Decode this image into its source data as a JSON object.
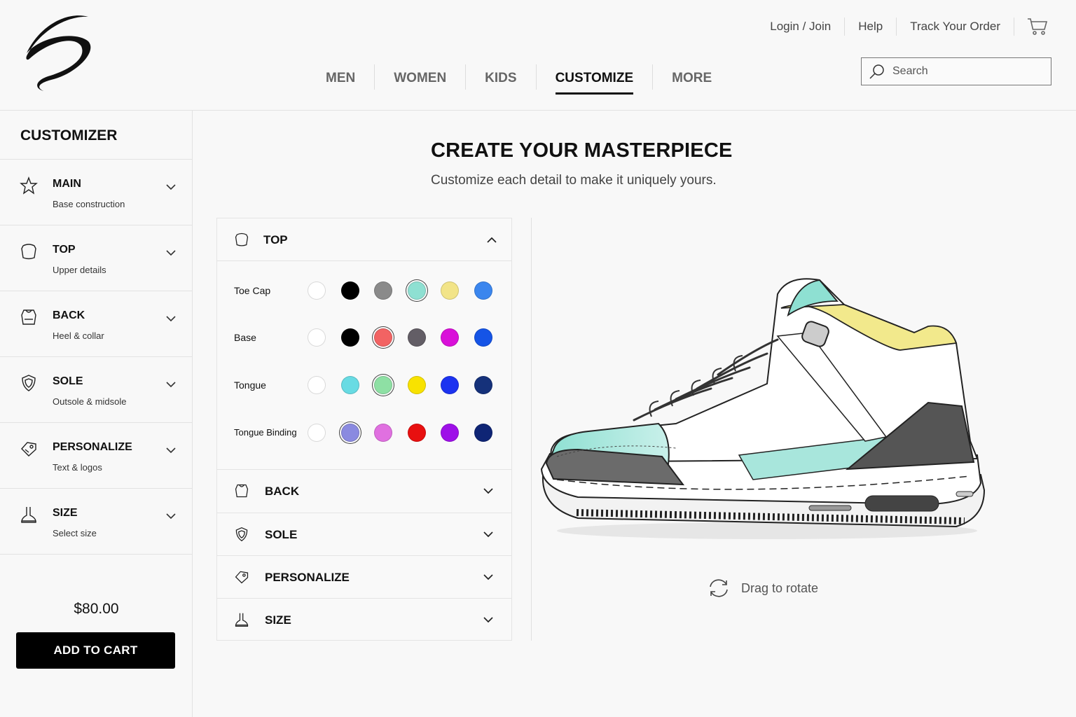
{
  "header": {
    "util_links": [
      "Login / Join",
      "Help",
      "Track Your Order"
    ],
    "nav": [
      "MEN",
      "WOMEN",
      "KIDS",
      "CUSTOMIZE",
      "MORE"
    ],
    "active_nav": "CUSTOMIZE",
    "search_placeholder": "Search"
  },
  "sidebar": {
    "title": "CUSTOMIZER",
    "items": [
      {
        "title": "MAIN",
        "subtitle": "Base construction",
        "icon": "star-icon"
      },
      {
        "title": "TOP",
        "subtitle": "Upper details",
        "icon": "shirt-icon"
      },
      {
        "title": "BACK",
        "subtitle": "Heel & collar",
        "icon": "heel-icon"
      },
      {
        "title": "SOLE",
        "subtitle": "Outsole & midsole",
        "icon": "shield-icon"
      },
      {
        "title": "PERSONALIZE",
        "subtitle": "Text & logos",
        "icon": "tag-icon"
      },
      {
        "title": "SIZE",
        "subtitle": "Select size",
        "icon": "foot-icon"
      }
    ],
    "price": "$80.00",
    "add_to_cart": "ADD TO CART"
  },
  "main": {
    "title": "CREATE YOUR MASTERPIECE",
    "subtitle": "Customize each detail to make it uniquely yours.",
    "panel": {
      "open_section": "TOP",
      "rows": [
        {
          "label": "Toe Cap",
          "colors": [
            "#ffffff",
            "#000000",
            "#8a8a8a",
            "#8ee0d2",
            "#f2e488",
            "#3b86ee"
          ],
          "selected": 3
        },
        {
          "label": "Base",
          "colors": [
            "#ffffff",
            "#000000",
            "#f26363",
            "#635e66",
            "#d910d9",
            "#1554e6"
          ],
          "selected": 2
        },
        {
          "label": "Tongue",
          "colors": [
            "#ffffff",
            "#68dbe3",
            "#8ee0a4",
            "#f8e200",
            "#1c33f0",
            "#15317a"
          ],
          "selected": 2
        },
        {
          "label": "Tongue Binding",
          "colors": [
            "#ffffff",
            "#8a8ae0",
            "#e070e0",
            "#e81010",
            "#9e10e8",
            "#0f2575"
          ],
          "selected": 1
        }
      ],
      "sections": [
        "BACK",
        "SOLE",
        "PERSONALIZE",
        "SIZE"
      ]
    },
    "rotate_hint": "Drag to rotate"
  }
}
